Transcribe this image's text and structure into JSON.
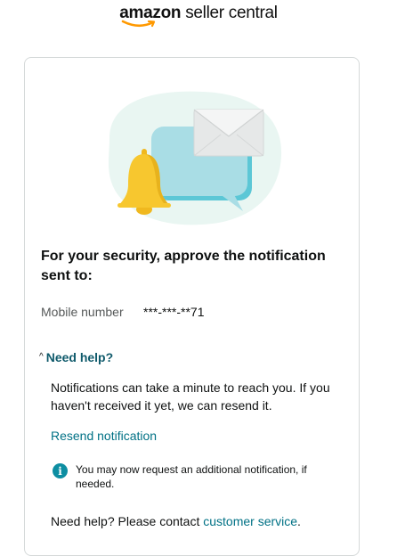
{
  "brand": {
    "name_bold": "amazon",
    "name_rest": " seller central",
    "accent_color": "#ff9900"
  },
  "card": {
    "heading": "For your security, approve the notification sent to:",
    "mobile": {
      "label": "Mobile number",
      "value": "***-***-**71"
    },
    "help": {
      "toggle_label": "Need help?",
      "expanded": true,
      "caret_icon": "caret-up-icon",
      "body": "Notifications can take a minute to reach you. If you haven't received it yet, we can resend it.",
      "resend_link": "Resend notification",
      "info_message": "You may now request an additional notification, if needed.",
      "contact_prefix": "Need help? Please contact ",
      "contact_link": "customer service",
      "contact_suffix": "."
    }
  },
  "colors": {
    "link": "#007185",
    "info": "#0d8ea2",
    "bell": "#f7c72f",
    "bubble": "#a9dde5",
    "blob": "#e9f6f2"
  }
}
